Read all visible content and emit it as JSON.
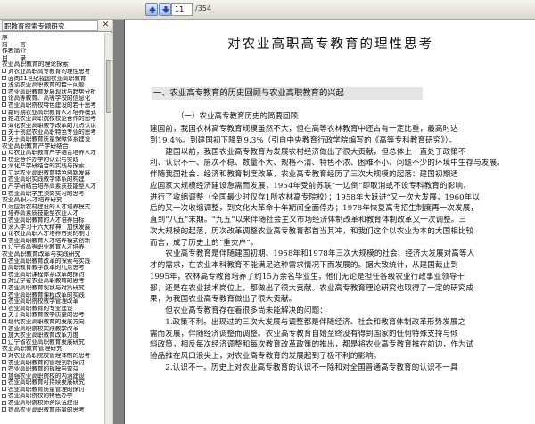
{
  "toolbar": {
    "current_page": "11",
    "total_pages": "/354"
  },
  "left_pane": {
    "tab_label": "职教育探索专题研究"
  },
  "toc": [
    {
      "label": "序",
      "box": false
    },
    {
      "label": "前　　言",
      "box": false
    },
    {
      "label": "作者简介",
      "box": false
    },
    {
      "label": "目　　录",
      "box": false
    },
    {
      "label": "农业高职教育的理论探索",
      "box": false
    },
    {
      "label": "对农业高职高专教育的理性思考",
      "box": true
    },
    {
      "label": "面向21世纪我国农业高职教育",
      "box": true
    },
    {
      "label": "浅谈农业高职教育的若干问题",
      "box": true
    },
    {
      "label": "农业高职教育发展现状与趋势分析",
      "box": true
    },
    {
      "label": "论高等教育、高等学校的信息化",
      "box": true
    },
    {
      "label": "农业高职院校特色建设的若干思考",
      "box": true
    },
    {
      "label": "新时期农业高职教育人才培养模式",
      "box": true
    },
    {
      "label": "推进农业高职院校校企合作的思考",
      "box": true
    },
    {
      "label": "深化农业高职教学改革的几点认识",
      "box": true
    },
    {
      "label": "关于创建农业高职特色专业的思考",
      "box": true
    },
    {
      "label": "关于高职教育质量保障体系建设",
      "box": true
    },
    {
      "label": "农业高职教育产学研结合",
      "box": false
    },
    {
      "label": "以农业高职教育产学结合培养人才",
      "box": true
    },
    {
      "label": "校企合作办学的认识与实践",
      "box": true
    },
    {
      "label": "深化产学研结合的实践与探索",
      "box": true
    },
    {
      "label": "立足农业高职教育特色创新发展",
      "box": true
    },
    {
      "label": "农业高职实践教学体系的构建",
      "box": true
    },
    {
      "label": "产学研结合培养高素质技能型人才",
      "box": true
    },
    {
      "label": "农业高职学生顶岗实习的思考",
      "box": true
    },
    {
      "label": "农业高职人才培养研究",
      "box": false
    },
    {
      "label": "适应新农村建设的人才培养模式",
      "box": true
    },
    {
      "label": "培养高素质技能型农业人才",
      "box": true
    },
    {
      "label": "农业高职教育的人才培养目标",
      "box": true
    },
    {
      "label": "深入学习十六大精神　加快发展",
      "box": true
    },
    {
      "label": "论农业高职人才培养方案的制订",
      "box": true
    },
    {
      "label": "农业高职教育人才培养模式创新",
      "box": true
    },
    {
      "label": "辽宁省高等职业教育人才培养",
      "box": true
    },
    {
      "label": "农业高职教育改革与实践研究",
      "box": false
    },
    {
      "label": "农业高职教育改革的探索与实践",
      "box": true
    },
    {
      "label": "高职教育教学改革的几点思考",
      "box": true
    },
    {
      "label": "农业高职课程体系改革的探讨",
      "box": true
    },
    {
      "label": "对辽宁省农业高职教育的思考",
      "box": true
    },
    {
      "label": "农业高职教育现状与对策研究",
      "box": true
    },
    {
      "label": "农业高职教育课程改革的实践",
      "box": true
    },
    {
      "label": "农业高职院校教学管理改革",
      "box": true
    },
    {
      "label": "农业高职教育的专业建设",
      "box": true
    },
    {
      "label": "关于高职教育教学质量的思考",
      "box": true
    },
    {
      "label": "现代农业高职教育的发展方向",
      "box": true
    },
    {
      "label": "农业高职院校实践教学改革",
      "box": true
    },
    {
      "label": "加大农业高职教育改革力度",
      "box": true
    },
    {
      "label": "辽宁省农业高职教育发展研究",
      "box": true
    },
    {
      "label": "农业高职教育管理研究",
      "box": false
    },
    {
      "label": "对农业高职院校管理体制的思考",
      "box": true
    },
    {
      "label": "农业高职教育的管理创新探讨",
      "box": true
    },
    {
      "label": "农业高职教育的规模与效益",
      "box": true
    },
    {
      "label": "加强农业高职院校的内涵建设",
      "box": true
    },
    {
      "label": "农业高职教育可持续发展研究",
      "box": true
    },
    {
      "label": "农业高职教育质量管理的探讨",
      "box": true
    },
    {
      "label": "农业高职院校的特色办学",
      "box": true
    },
    {
      "label": "农业高职院校师资队伍建设",
      "box": true
    },
    {
      "label": "提高农业高职教育质量的思考",
      "box": true
    }
  ],
  "document": {
    "title": "对农业高职高专教育的理性思考",
    "section_heading": "一、农业高专教育的历史回顾与农业高职教育的兴起",
    "subheading": "（一）农业高专教育历史的简要回顾",
    "lines": [
      "建国前，我国农林高专教育规模虽然不大，但在高等农林教育中还占有一定比重，最高时达",
      "到19.4%。到建国初下降到9.3%（引自中央教育行政学院编写的《高等专科教育研究》）。",
      "　　建国以前，我国农业高专教育为发展农村经济做出了很大贡献，但总体上一直处于政策不",
      "利、认识不一、层次不稳、数量不大、规格不清、特色不浓、困难不小、问题不少的环境中生存与发展。",
      "伴随我国社会、经济和教育制度改革，农业高专教育经历了三次大规模的起落：建国初期适",
      "应国家大规模经济建设急需而发展，1954年受前苏联“一边倒”即取消或不设专科教育的影响，",
      "进行了收缩调整（全国最少时仅存1所农林高专院校）；1958年大跃进“又一次大发展，1960年以",
      "后的又一次收缩调整，到文化大革命十年期间全面停办；1978年恢复高考招生制度再一次发展，",
      "直到“八五”末期。“九五”以来伴随社会主义市场经济体制改革和教育体制改革又一次调整。三",
      "次大规模的起落，历次改革调整农业高专教育都首当其冲，和我们这个以农业为本的大国相比较",
      "而言，成了历史上的“重灾户”。",
      "　　农业高专教育是伴随建国初期、1958年和1978年三次大规模的社会、经济大发展对高等人",
      "才的需求，在农业本科教育不能满足这种需求情况下而发展的。据大致统计，从建国截止到",
      "1995年，农林高专教育培养了约15万余名毕业生，他们无论是担任各级农业行政事业领导干",
      "部，还是在农业技术岗位上，都做出了很大贡献。农业高专教育理论研究也取得了一定的研究成",
      "果，为我国农业高专教育做出了很大贡献。",
      "　　但农业高专教育存在着很多尚未能解决的问题：",
      "　　1.政策不利。出现过的三次大发展与调整都是伴随经济、社会和教育体制改革形势发展之",
      "需而发展，伴随经济调整而调整。农业高专教育自始至终没有得到国家的任何特殊支持与倾",
      "斜政策，相反每次经济调整和每次教育改革政策的推出，都是将农业高专教育推在前边，作为试",
      "验品推在风口浪尖上，对农业高专教育的发展起到了极不利的影响。",
      "　　2.认识不一。历史上对农业高专教育的认识不一除和对全国普通高专教育的认识不一具"
    ]
  }
}
